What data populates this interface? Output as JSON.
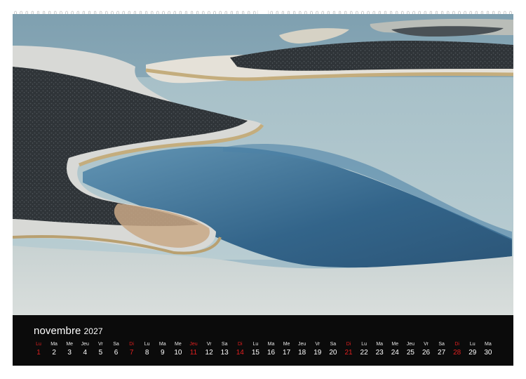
{
  "calendar": {
    "month": "novembre",
    "year": "2027",
    "days": [
      {
        "name": "Lu",
        "num": "1",
        "red": true
      },
      {
        "name": "Ma",
        "num": "2",
        "red": false
      },
      {
        "name": "Me",
        "num": "3",
        "red": false
      },
      {
        "name": "Jeu",
        "num": "4",
        "red": false
      },
      {
        "name": "Vr",
        "num": "5",
        "red": false
      },
      {
        "name": "Sa",
        "num": "6",
        "red": false
      },
      {
        "name": "Di",
        "num": "7",
        "red": true
      },
      {
        "name": "Lu",
        "num": "8",
        "red": false
      },
      {
        "name": "Ma",
        "num": "9",
        "red": false
      },
      {
        "name": "Me",
        "num": "10",
        "red": false
      },
      {
        "name": "Jeu",
        "num": "11",
        "red": true
      },
      {
        "name": "Vr",
        "num": "12",
        "red": false
      },
      {
        "name": "Sa",
        "num": "13",
        "red": false
      },
      {
        "name": "Di",
        "num": "14",
        "red": true
      },
      {
        "name": "Lu",
        "num": "15",
        "red": false
      },
      {
        "name": "Ma",
        "num": "16",
        "red": false
      },
      {
        "name": "Me",
        "num": "17",
        "red": false
      },
      {
        "name": "Jeu",
        "num": "18",
        "red": false
      },
      {
        "name": "Vr",
        "num": "19",
        "red": false
      },
      {
        "name": "Sa",
        "num": "20",
        "red": false
      },
      {
        "name": "Di",
        "num": "21",
        "red": true
      },
      {
        "name": "Lu",
        "num": "22",
        "red": false
      },
      {
        "name": "Ma",
        "num": "23",
        "red": false
      },
      {
        "name": "Me",
        "num": "24",
        "red": false
      },
      {
        "name": "Jeu",
        "num": "25",
        "red": false
      },
      {
        "name": "Vr",
        "num": "26",
        "red": false
      },
      {
        "name": "Sa",
        "num": "27",
        "red": false
      },
      {
        "name": "Di",
        "num": "28",
        "red": true
      },
      {
        "name": "Lu",
        "num": "29",
        "red": false
      },
      {
        "name": "Ma",
        "num": "30",
        "red": false
      }
    ]
  },
  "colors": {
    "strip_background": "#0b0b0b",
    "holiday_red": "#e02020",
    "day_text": "#ffffff"
  }
}
